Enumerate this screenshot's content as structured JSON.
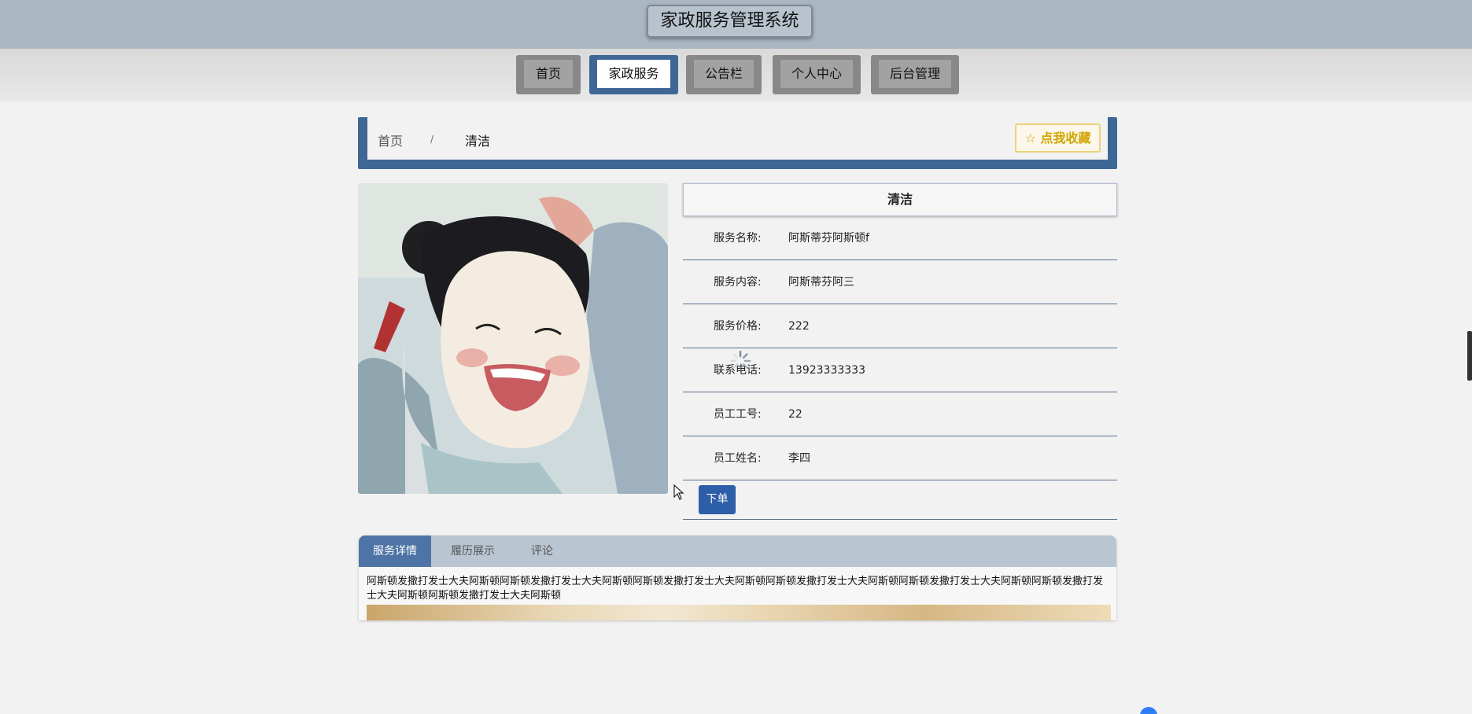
{
  "header": {
    "title": "家政服务管理系统"
  },
  "nav": {
    "items": [
      {
        "label": "首页"
      },
      {
        "label": "家政服务"
      },
      {
        "label": "公告栏"
      },
      {
        "label": "个人中心"
      },
      {
        "label": "后台管理"
      }
    ],
    "active_index": 1
  },
  "breadcrumb": {
    "home": "首页",
    "separator": "/",
    "current": "清洁"
  },
  "favorite": {
    "icon": "star-outline-icon",
    "label": "点我收藏"
  },
  "detail": {
    "title": "清洁",
    "fields": [
      {
        "label": "服务名称:",
        "value": "阿斯蒂芬阿斯顿f"
      },
      {
        "label": "服务内容:",
        "value": "阿斯蒂芬阿三"
      },
      {
        "label": "服务价格:",
        "value": "222"
      },
      {
        "label": "联系电话:",
        "value": "13923333333"
      },
      {
        "label": "员工工号:",
        "value": "22"
      },
      {
        "label": "员工姓名:",
        "value": "李四"
      }
    ],
    "order_label": "下单"
  },
  "tabs": {
    "items": [
      {
        "label": "服务详情"
      },
      {
        "label": "履历展示"
      },
      {
        "label": "评论"
      }
    ],
    "active_index": 0,
    "content_text": "阿斯顿发撒打发士大夫阿斯顿阿斯顿发撒打发士大夫阿斯顿阿斯顿发撒打发士大夫阿斯顿阿斯顿发撒打发士大夫阿斯顿阿斯顿发撒打发士大夫阿斯顿阿斯顿发撒打发士大夫阿斯顿阿斯顿发撒打发士大夫阿斯顿"
  },
  "colors": {
    "topbar": "#aab6c1",
    "accent_blue": "#3f6796",
    "order_button": "#2d5ea8",
    "favorite_gold": "#d2a400"
  }
}
